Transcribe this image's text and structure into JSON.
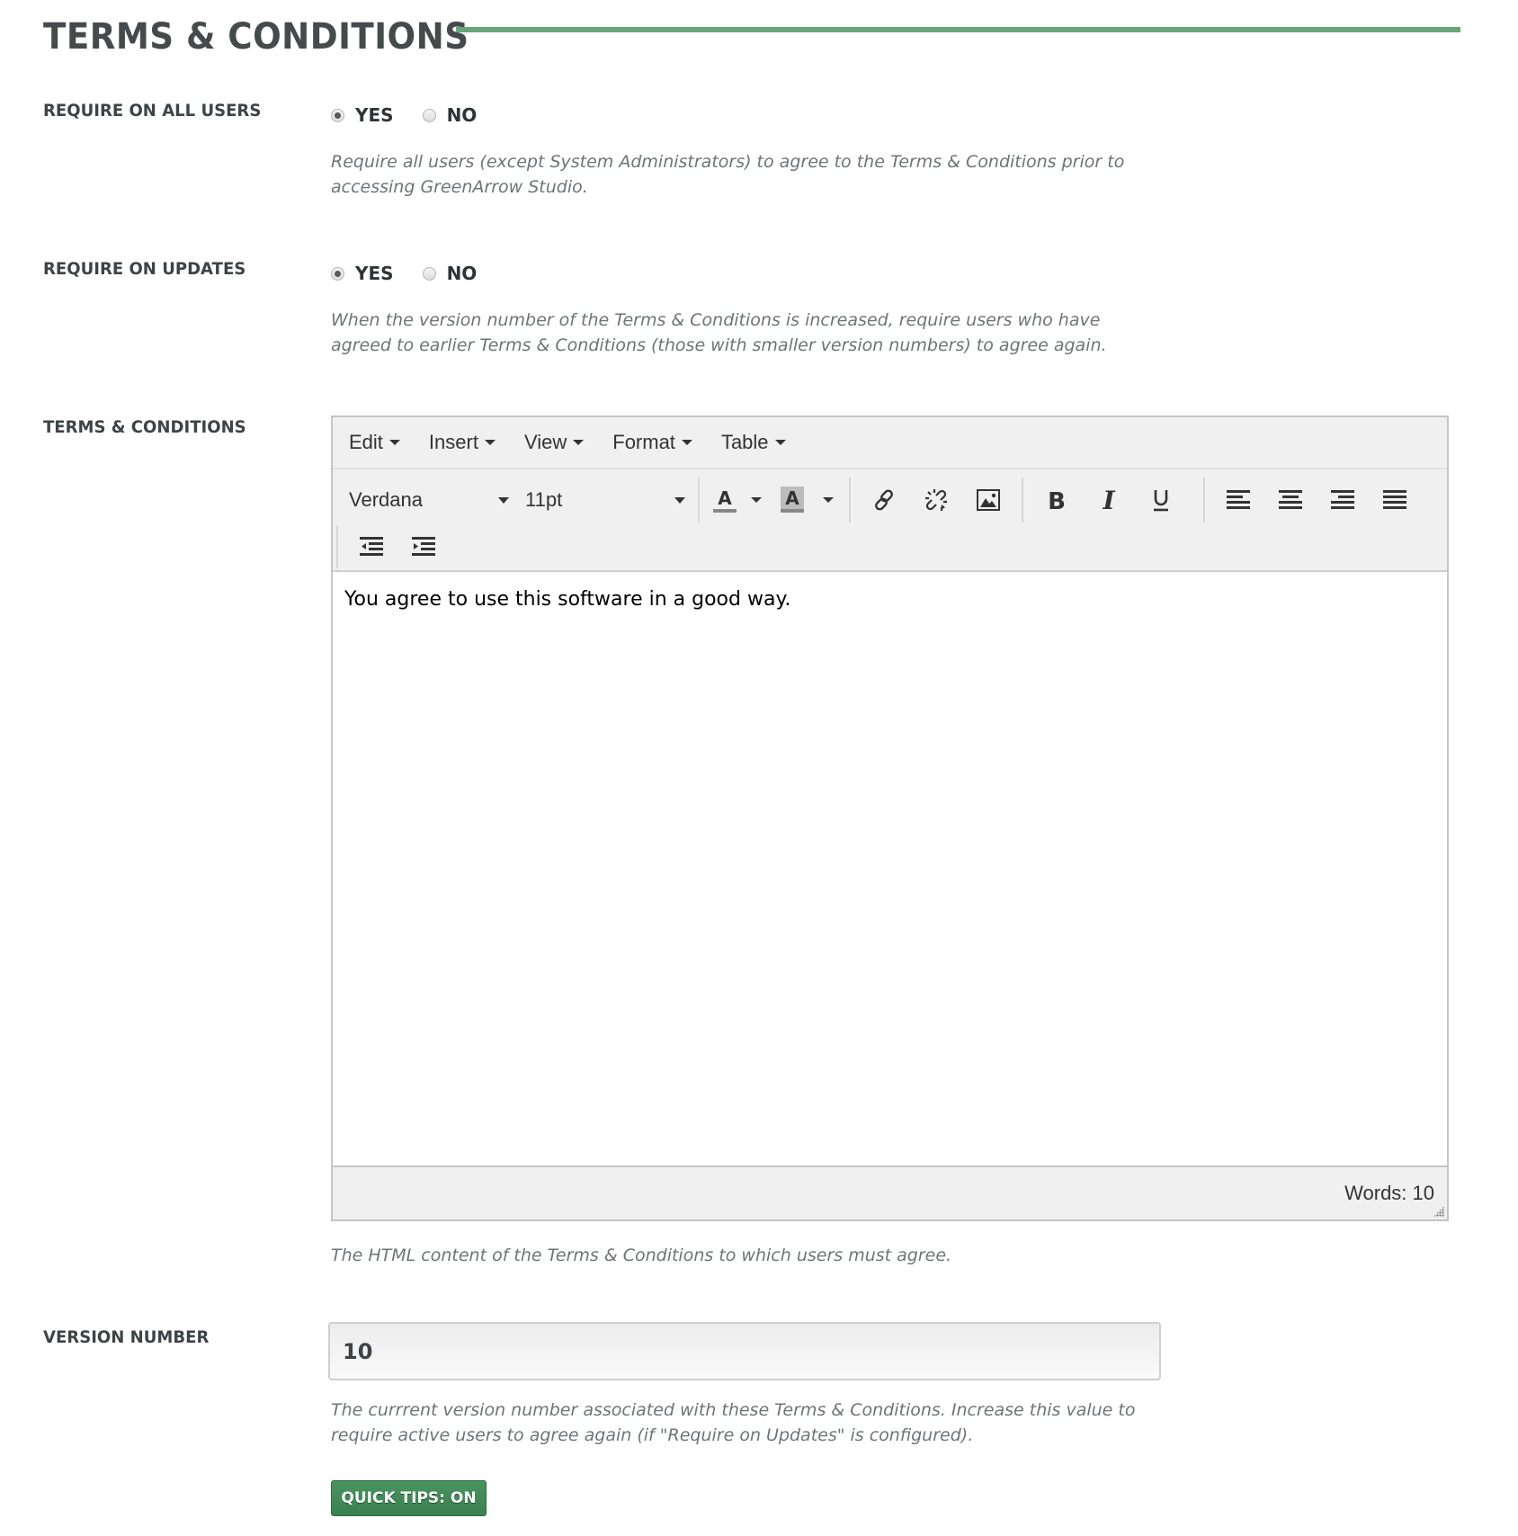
{
  "section": {
    "title": "TERMS & CONDITIONS",
    "accent_color": "#68a678"
  },
  "require_all_users": {
    "label": "REQUIRE ON ALL USERS",
    "options": [
      {
        "label": "YES",
        "selected": true
      },
      {
        "label": "NO",
        "selected": false
      }
    ],
    "help": "Require all users (except System Administrators) to agree to the Terms & Conditions prior to accessing GreenArrow Studio."
  },
  "require_on_updates": {
    "label": "REQUIRE ON UPDATES",
    "options": [
      {
        "label": "YES",
        "selected": true
      },
      {
        "label": "NO",
        "selected": false
      }
    ],
    "help": "When the version number of the Terms & Conditions is increased, require users who have agreed to earlier Terms & Conditions (those with smaller version numbers) to agree again."
  },
  "terms": {
    "label": "TERMS & CONDITIONS",
    "editor": {
      "menus": [
        "Edit",
        "Insert",
        "View",
        "Format",
        "Table"
      ],
      "font_family": "Verdana",
      "font_size": "11pt",
      "toolbar_icons": [
        "text-color-icon",
        "background-color-icon",
        "link-icon",
        "unlink-icon",
        "image-icon",
        "bold-icon",
        "italic-icon",
        "underline-icon",
        "align-left-icon",
        "align-center-icon",
        "align-right-icon",
        "align-justify-icon",
        "outdent-icon",
        "indent-icon"
      ],
      "content": "You agree to use this software in a good way.",
      "word_count": "Words: 10"
    },
    "help": "The HTML content of the Terms & Conditions to which users must agree."
  },
  "version": {
    "label": "VERSION NUMBER",
    "value": "10",
    "help": "The currrent version number associated with these Terms & Conditions. Increase this value to require active users to agree again (if \"Require on Updates\" is configured)."
  },
  "quick_tips": {
    "label": "QUICK TIPS: ON"
  }
}
